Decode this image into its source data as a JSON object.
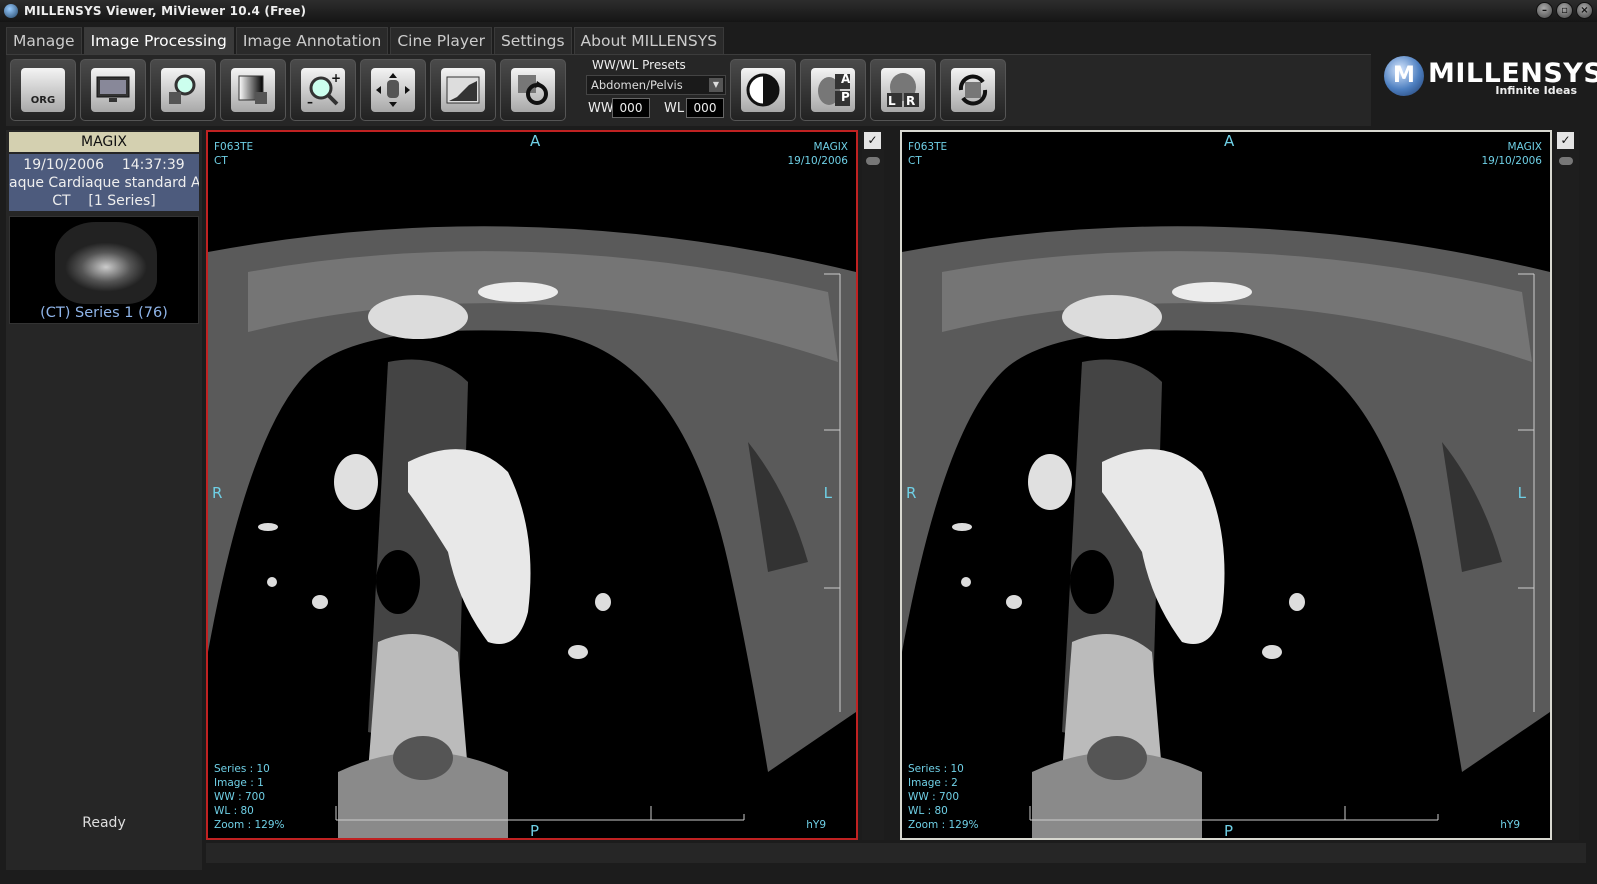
{
  "window": {
    "title": "MILLENSYS Viewer, MiViewer 10.4 (Free)"
  },
  "tabs": [
    {
      "label": "Manage",
      "active": false
    },
    {
      "label": "Image Processing",
      "active": true
    },
    {
      "label": "Image Annotation",
      "active": false
    },
    {
      "label": "Cine Player",
      "active": false
    },
    {
      "label": "Settings",
      "active": false
    },
    {
      "label": "About MILLENSYS",
      "active": false
    }
  ],
  "toolbar": {
    "org_label": "ORG",
    "presets_label": "WW/WL Presets",
    "preset_selected": "Abdomen/Pelvis",
    "ww_label": "WW",
    "ww_value": "000",
    "wl_label": "WL",
    "wl_value": "000",
    "ap_a": "A",
    "ap_p": "P",
    "lr_l": "L",
    "lr_r": "R"
  },
  "logo": {
    "name": "MILLENSYS",
    "slogan": "Infinite Ideas",
    "mark": "M"
  },
  "sidebar": {
    "patient_name": "MAGIX",
    "date": "19/10/2006",
    "time": "14:37:39",
    "study": "aque Cardiaque standard  Ad",
    "modality": "CT",
    "series_count": "[1 Series]",
    "series_caption": "(CT) Series 1 (76)",
    "status": "Ready"
  },
  "viewports": [
    {
      "patient_id": "F063TE",
      "modality": "CT",
      "patient_name": "MAGIX",
      "date": "19/10/2006",
      "top": "A",
      "bottom": "P",
      "left": "R",
      "right": "L",
      "series": "Series : 10",
      "image": "Image : 1",
      "ww": "WW    : 700",
      "wl": "WL    : 80",
      "zoom": "Zoom : 129%",
      "corner": "hY9"
    },
    {
      "patient_id": "F063TE",
      "modality": "CT",
      "patient_name": "MAGIX",
      "date": "19/10/2006",
      "top": "A",
      "bottom": "P",
      "left": "R",
      "right": "L",
      "series": "Series : 10",
      "image": "Image : 2",
      "ww": "WW    : 700",
      "wl": "WL    : 80",
      "zoom": "Zoom : 129%",
      "corner": "hY9"
    }
  ],
  "colors": {
    "active_border": "#c02222",
    "overlay_text": "#6fd0e6",
    "patient_bar": "#d4d0b0",
    "study_bar": "#4d5b7d"
  }
}
